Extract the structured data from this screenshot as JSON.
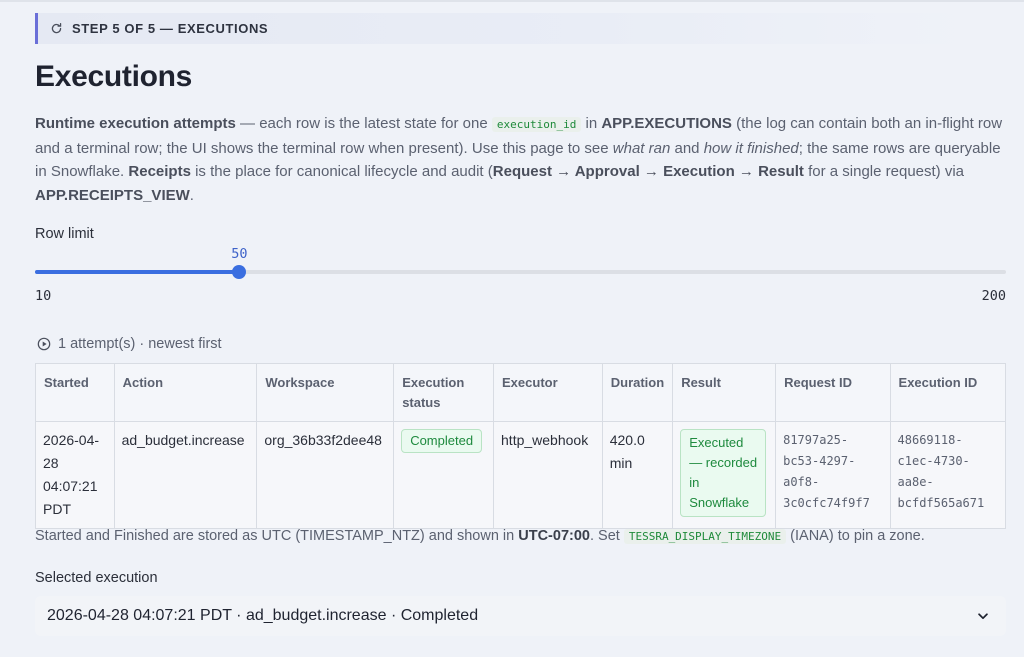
{
  "step_banner": {
    "text": "STEP 5 OF 5 — EXECUTIONS",
    "icon": "refresh-icon"
  },
  "page_title": "Executions",
  "intro": {
    "bold_lead": "Runtime execution attempts",
    "t1": " — each row is the latest state for one ",
    "code1": "execution_id",
    "t2": " in ",
    "bold_table": "APP.EXECUTIONS",
    "t3": " (the log can contain both an in-flight row and a terminal row; the UI shows the terminal row when present). Use this page to see ",
    "ital1": "what ran",
    "t4": " and ",
    "ital2": "how it finished",
    "t5": "; the same rows are queryable in Snowflake. ",
    "bold_receipts": "Receipts",
    "t6": " is the place for canonical lifecycle and audit (",
    "bold_flow": "Request → Approval → Execution → Result",
    "t7": " for a single request) via ",
    "bold_view": "APP.RECEIPTS_VIEW",
    "t8": "."
  },
  "row_limit": {
    "label": "Row limit",
    "value": 50,
    "min": 10,
    "max": 200
  },
  "attempts_text": "1 attempt(s) · newest first",
  "table": {
    "headers": [
      "Started",
      "Action",
      "Workspace",
      "Execution status",
      "Executor",
      "Duration",
      "Result",
      "Request ID",
      "Execution ID"
    ],
    "rows": [
      {
        "started": "2026-04-28 04:07:21 PDT",
        "action": "ad_budget.increase",
        "workspace": "org_36b33f2dee48",
        "status": "Completed",
        "executor": "http_webhook",
        "duration": "420.0 min",
        "result": "Executed — recorded in Snowflake",
        "request_id": "81797a25-bc53-4297-a0f8-3c0cfc74f9f7",
        "execution_id": "48669118-c1ec-4730-aa8e-bcfdf565a671"
      }
    ]
  },
  "footnote": {
    "t1": "Started and Finished are stored as UTC (TIMESTAMP_NTZ) and shown in ",
    "bold_tz": "UTC-07:00",
    "t2": ". Set ",
    "code": "TESSRA_DISPLAY_TIMEZONE",
    "t3": " (IANA) to pin a zone."
  },
  "selected_execution": {
    "label": "Selected execution",
    "value": "2026-04-28 04:07:21 PDT · ad_budget.increase · Completed",
    "icon": "chevron-down-icon"
  },
  "colors": {
    "accent": "#3a6ee0",
    "success": "#1e8a3e",
    "banner_bar": "#6a6fd8"
  }
}
